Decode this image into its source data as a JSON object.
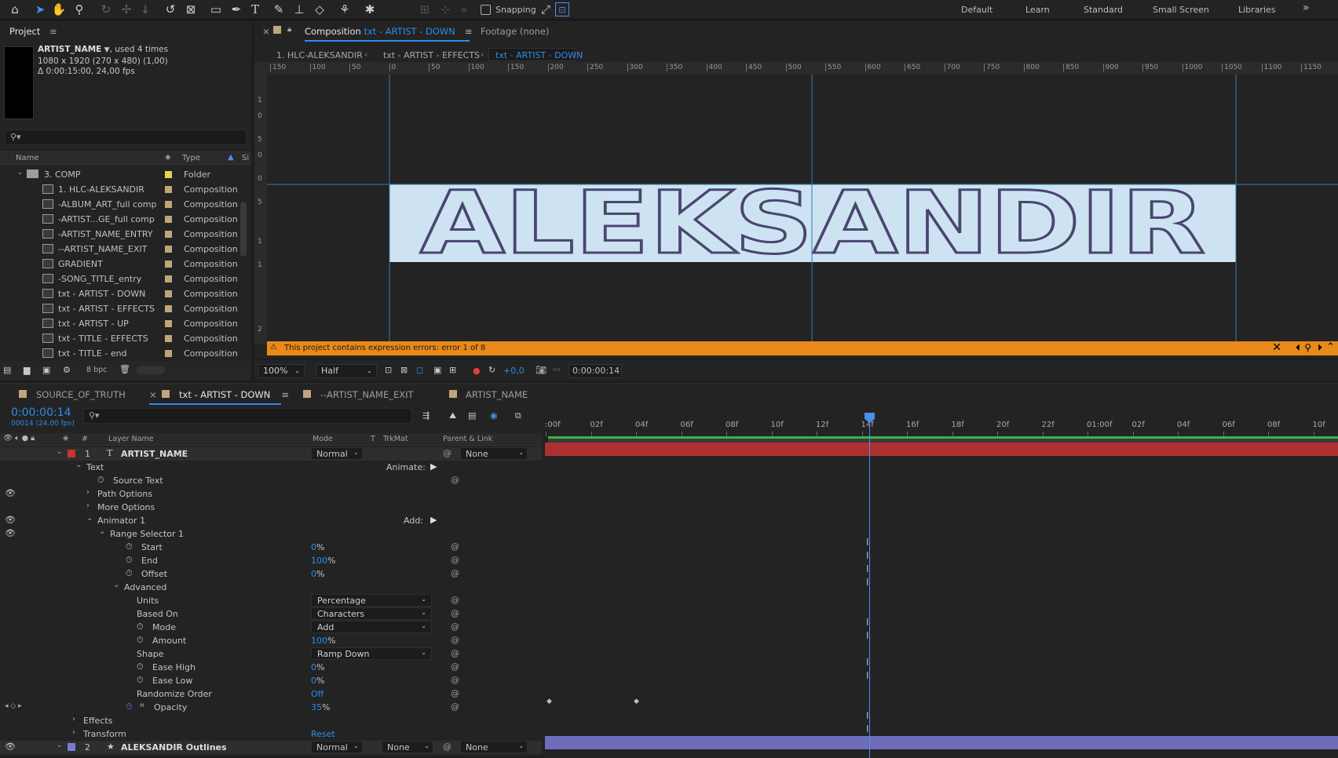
{
  "toolbar": {
    "snapping_label": "Snapping",
    "workspaces": [
      "Default",
      "Learn",
      "Standard",
      "Small Screen",
      "Libraries"
    ],
    "overflow": "»"
  },
  "project": {
    "tab_label": "Project",
    "selected_name": "ARTIST_NAME",
    "used_text": ", used 4 times",
    "dims": "1080 x 1920  (270 x 480) (1,00)",
    "duration": "Δ 0:00:15:00, 24,00 fps",
    "col_name": "Name",
    "col_type": "Type",
    "col_size": "Si",
    "folder": {
      "name": "3. COMP",
      "type": "Folder"
    },
    "items": [
      {
        "name": "1. HLC-ALEKSANDIR",
        "type": "Composition"
      },
      {
        "name": "-ALBUM_ART_full comp",
        "type": "Composition"
      },
      {
        "name": "-ARTIST...GE_full comp",
        "type": "Composition"
      },
      {
        "name": "-ARTIST_NAME_ENTRY",
        "type": "Composition"
      },
      {
        "name": "--ARTIST_NAME_EXIT",
        "type": "Composition"
      },
      {
        "name": "GRADIENT",
        "type": "Composition"
      },
      {
        "name": "-SONG_TITLE_entry",
        "type": "Composition"
      },
      {
        "name": "txt - ARTIST - DOWN",
        "type": "Composition"
      },
      {
        "name": "txt - ARTIST - EFFECTS",
        "type": "Composition"
      },
      {
        "name": "txt - ARTIST - UP",
        "type": "Composition"
      },
      {
        "name": "txt - TITLE - EFFECTS",
        "type": "Composition"
      },
      {
        "name": "txt - TITLE - end",
        "type": "Composition"
      }
    ],
    "bpc": "8 bpc"
  },
  "comp": {
    "tab_prefix": "Composition",
    "tab_name": "txt - ARTIST - DOWN",
    "footage_tab": "Footage (none)",
    "breadcrumbs": [
      "1. HLC-ALEKSANDIR",
      "txt - ARTIST - EFFECTS",
      "txt - ARTIST - DOWN"
    ],
    "ruler_h": [
      "150",
      "100",
      "50",
      "0",
      "50",
      "100",
      "150",
      "200",
      "250",
      "300",
      "350",
      "400",
      "450",
      "500",
      "550",
      "600",
      "650",
      "700",
      "750",
      "800",
      "850",
      "900",
      "950",
      "1000",
      "1050",
      "1100",
      "1150"
    ],
    "ruler_v": [
      "1",
      "0",
      "5",
      "0",
      "0",
      "5",
      "1",
      "1",
      "2"
    ],
    "text": "ALEKSANDIR",
    "error_text": "This project contains expression errors: error 1 of 8",
    "zoom": "100%",
    "resolution": "Half",
    "exposure": "+0,0",
    "timecode": "0:00:00:14"
  },
  "timeline": {
    "tabs": [
      "SOURCE_OF_TRUTH",
      "txt - ARTIST - DOWN",
      "--ARTIST_NAME_EXIT",
      "ARTIST_NAME"
    ],
    "timecode": "0:00:00:14",
    "frames": "00014 (24.00 fps)",
    "col_hash": "#",
    "col_layer": "Layer Name",
    "col_mode": "Mode",
    "col_t": "T",
    "col_trkmat": "TrkMat",
    "col_parent": "Parent & Link",
    "ticks": [
      ":00f",
      "02f",
      "04f",
      "06f",
      "08f",
      "10f",
      "12f",
      "14f",
      "16f",
      "18f",
      "20f",
      "22f",
      "01:00f",
      "02f",
      "04f",
      "06f",
      "08f",
      "10f"
    ],
    "layer1": {
      "num": "1",
      "name": "ARTIST_NAME",
      "mode": "Normal",
      "parent": "None"
    },
    "animate_label": "Animate:",
    "add_label": "Add:",
    "props": {
      "text": "Text",
      "source_text": "Source Text",
      "path_options": "Path Options",
      "more_options": "More Options",
      "animator": "Animator 1",
      "range": "Range Selector 1",
      "start": "Start",
      "start_val": "0",
      "start_unit": "%",
      "end": "End",
      "end_val": "100",
      "end_unit": "%",
      "offset": "Offset",
      "offset_val": "0",
      "offset_unit": "%",
      "advanced": "Advanced",
      "units": "Units",
      "units_val": "Percentage",
      "based_on": "Based On",
      "based_on_val": "Characters",
      "mode": "Mode",
      "mode_val": "Add",
      "amount": "Amount",
      "amount_val": "100",
      "amount_unit": "%",
      "shape": "Shape",
      "shape_val": "Ramp Down",
      "ease_high": "Ease High",
      "ease_high_val": "0",
      "ease_high_unit": "%",
      "ease_low": "Ease Low",
      "ease_low_val": "0",
      "ease_low_unit": "%",
      "randomize": "Randomize Order",
      "randomize_val": "Off",
      "opacity": "Opacity",
      "opacity_val": "35",
      "opacity_unit": "%",
      "effects": "Effects",
      "transform": "Transform",
      "reset": "Reset"
    },
    "layer2": {
      "num": "2",
      "name": "ALEKSANDIR Outlines",
      "mode": "Normal",
      "trkmat": "None",
      "parent": "None"
    }
  },
  "colors": {
    "accent_blue": "#2d8ceb",
    "error_orange": "#e8891a",
    "label_red": "#c83232",
    "label_purple": "#7a7ad6",
    "text_fill": "#cde3f2"
  }
}
